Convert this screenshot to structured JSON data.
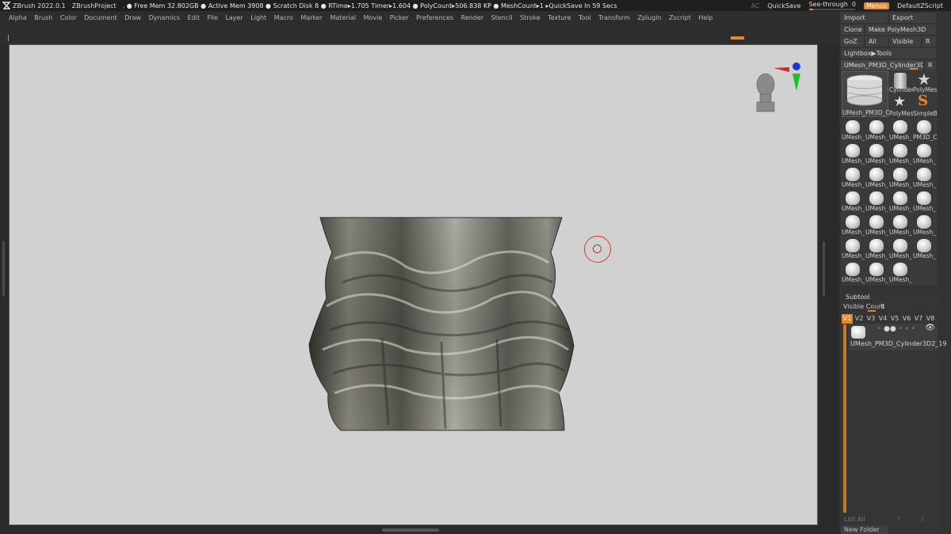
{
  "titlebar": {
    "app": "ZBrush 2022.0.1",
    "project": "ZBrushProject",
    "status": ". ● Free Mem 32.802GB ● Active Mem 3908 ● Scratch Disk 8 ● RTime▸1.705 Timer▸1.604 ● PolyCount▸506.838 KP ● MeshCount▸1 ▸QuickSave In 59 Secs",
    "ac": "AC",
    "quicksave": "QuickSave",
    "see_through_label": "See-through",
    "see_through_value": "0",
    "menus": "Menus",
    "script": "DefaultZScript"
  },
  "menubar": [
    "Alpha",
    "Brush",
    "Color",
    "Document",
    "Draw",
    "Dynamics",
    "Edit",
    "File",
    "Layer",
    "Light",
    "Macro",
    "Marker",
    "Material",
    "Movie",
    "Picker",
    "Preferences",
    "Render",
    "Stencil",
    "Stroke",
    "Texture",
    "Tool",
    "Transform",
    "Zplugin",
    "Zscript",
    "Help"
  ],
  "tool_panel": {
    "import": "Import",
    "export": "Export",
    "clone": "Clone",
    "make_polymesh": "Make PolyMesh3D",
    "goz": "GoZ",
    "all": "All",
    "visible": "Visible",
    "r": "R",
    "lightbox": "Lightbox▶Tools",
    "current_tool": "UMesh_PM3D_Cylinder3D2_1",
    "current_tool_r": "R",
    "big_thumb_label": "UMesh_PM3D_C",
    "small_labels": [
      "Cylinder",
      "PolyMes",
      "PolyMes",
      "SimpleB"
    ],
    "grid_labels": [
      "UMesh_",
      "UMesh_",
      "UMesh_",
      "PM3D_C",
      "UMesh_",
      "UMesh_",
      "UMesh_",
      "UMesh_",
      "UMesh_",
      "UMesh_",
      "UMesh_",
      "UMesh_",
      "UMesh_",
      "UMesh_",
      "UMesh_",
      "UMesh_",
      "UMesh_",
      "UMesh_",
      "UMesh_",
      "UMesh_",
      "UMesh_",
      "UMesh_",
      "UMesh_",
      "UMesh_",
      "UMesh_",
      "UMesh_",
      "UMesh_"
    ]
  },
  "subtool": {
    "title": "Subtool",
    "visible_count_label": "Visible Count",
    "visible_count": "8",
    "versions": [
      "V1",
      "V2",
      "V3",
      "V4",
      "V5",
      "V6",
      "V7",
      "V8"
    ],
    "item_name": "UMesh_PM3D_Cylinder3D2_19",
    "list_all": "List All",
    "new_folder": "New Folder"
  },
  "colors": {
    "accent": "#e8862a",
    "canvas": "#d1d1d1",
    "cursor": "#d3382f"
  }
}
